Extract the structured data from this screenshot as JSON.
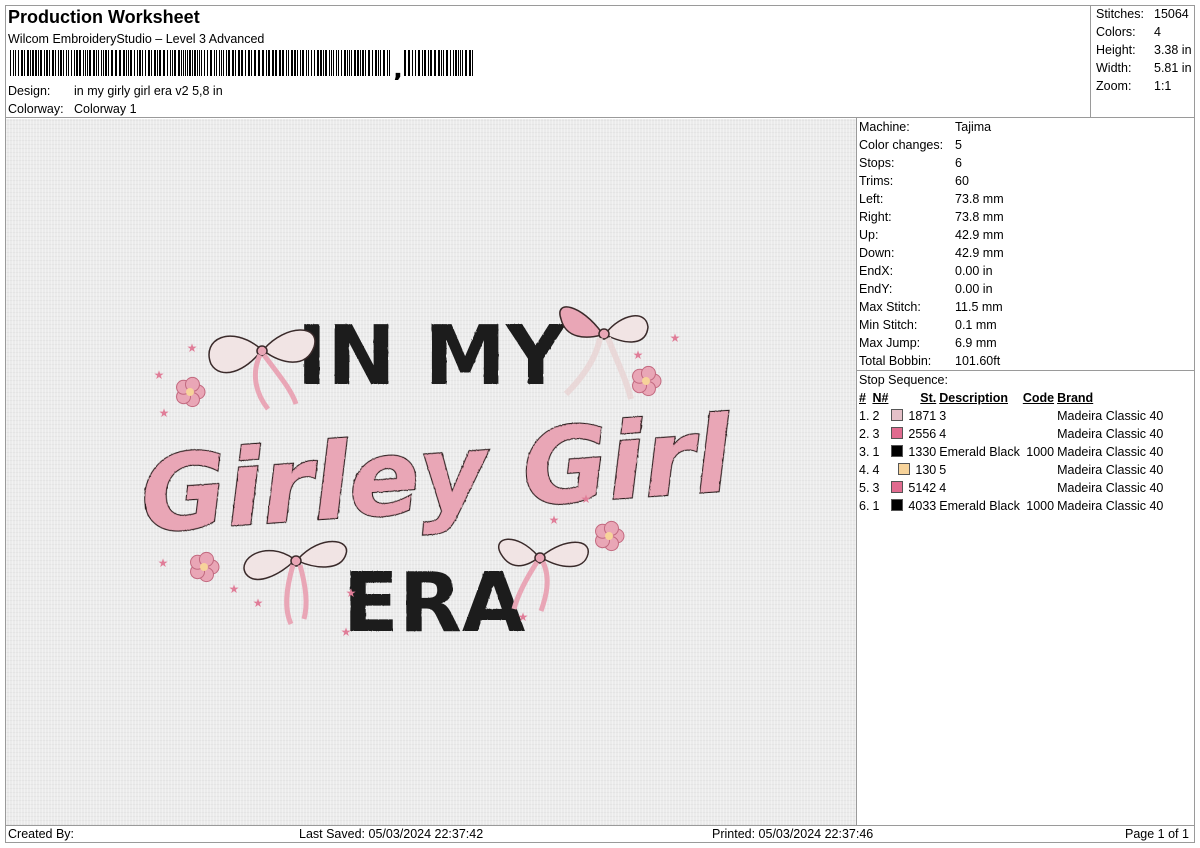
{
  "header": {
    "title": "Production Worksheet",
    "software": "Wilcom EmbroideryStudio – Level 3 Advanced",
    "design_label": "Design:",
    "design_value": "in my girly girl era  v2 5,8 in",
    "colorway_label": "Colorway:",
    "colorway_value": "Colorway 1"
  },
  "summary": [
    {
      "label": "Stitches:",
      "value": "15064"
    },
    {
      "label": "Colors:",
      "value": "4"
    },
    {
      "label": "Height:",
      "value": "3.38 in"
    },
    {
      "label": "Width:",
      "value": "5.81 in"
    },
    {
      "label": "Zoom:",
      "value": "1:1"
    }
  ],
  "machine_info": [
    {
      "label": "Machine:",
      "value": "Tajima"
    },
    {
      "label": "Color changes:",
      "value": "5"
    },
    {
      "label": "Stops:",
      "value": "6"
    },
    {
      "label": "Trims:",
      "value": "60"
    },
    {
      "label": "Left:",
      "value": "73.8 mm"
    },
    {
      "label": "Right:",
      "value": "73.8 mm"
    },
    {
      "label": "Up:",
      "value": "42.9 mm"
    },
    {
      "label": "Down:",
      "value": "42.9 mm"
    },
    {
      "label": "EndX:",
      "value": "0.00 in"
    },
    {
      "label": "EndY:",
      "value": "0.00 in"
    },
    {
      "label": "Max Stitch:",
      "value": "11.5 mm"
    },
    {
      "label": "Min Stitch:",
      "value": "0.1 mm"
    },
    {
      "label": "Max Jump:",
      "value": "6.9 mm"
    },
    {
      "label": "Total Bobbin:",
      "value": "101.60ft"
    }
  ],
  "stop_sequence": {
    "title": "Stop Sequence:",
    "headers": [
      "#",
      "N#",
      "St.",
      "Description",
      "Code",
      "Brand"
    ],
    "rows": [
      {
        "num": "1.",
        "n": "2",
        "color": "#e5c0c8",
        "st": "1871",
        "desc": "3",
        "code": "",
        "brand": "Madeira Classic 40"
      },
      {
        "num": "2.",
        "n": "3",
        "color": "#e06b8f",
        "st": "2556",
        "desc": "4",
        "code": "",
        "brand": "Madeira Classic 40"
      },
      {
        "num": "3.",
        "n": "1",
        "color": "#000000",
        "st": "1330",
        "desc": "Emerald Black",
        "code": "1000",
        "brand": "Madeira Classic 40"
      },
      {
        "num": "4.",
        "n": "4",
        "color": "#f7d39a",
        "st": "130",
        "desc": "5",
        "code": "",
        "brand": "Madeira Classic 40"
      },
      {
        "num": "5.",
        "n": "3",
        "color": "#e06b8f",
        "st": "5142",
        "desc": "4",
        "code": "",
        "brand": "Madeira Classic 40"
      },
      {
        "num": "6.",
        "n": "1",
        "color": "#000000",
        "st": "4033",
        "desc": "Emerald Black",
        "code": "1000",
        "brand": "Madeira Classic 40"
      }
    ]
  },
  "design_text": {
    "line1": "IN MY",
    "line2": "Girley Girl",
    "line3": "ERA"
  },
  "colors": {
    "thread_pink": "#e9a6b6",
    "thread_black": "#1f1f1f",
    "bow_cream": "#f1e4e4",
    "fabric": "#ebebeb"
  },
  "footer": {
    "created": "Created By:",
    "last_saved": "Last Saved: 05/03/2024 22:37:42",
    "printed": "Printed: 05/03/2024 22:37:46",
    "page": "Page 1 of 1"
  }
}
